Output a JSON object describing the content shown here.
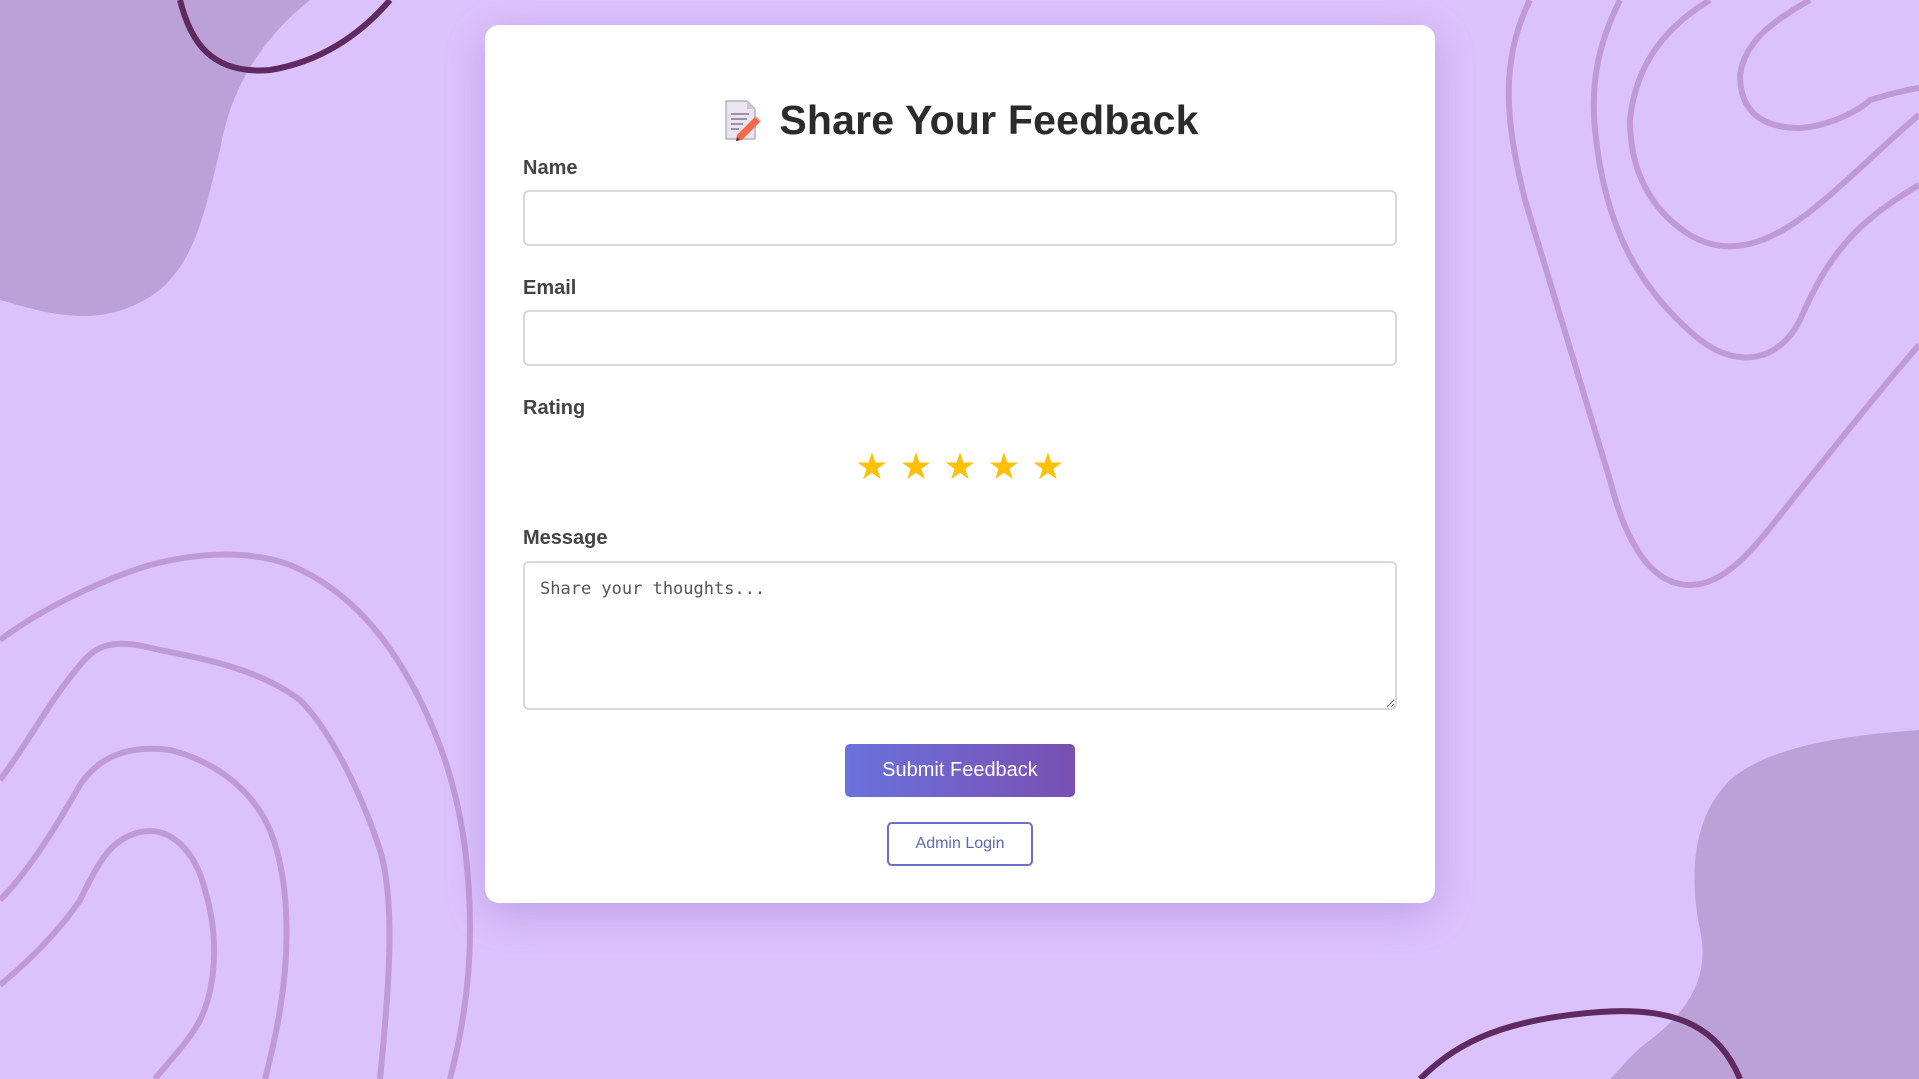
{
  "form": {
    "title": "Share Your Feedback",
    "title_icon": "memo-icon",
    "name_label": "Name",
    "name_value": "",
    "email_label": "Email",
    "email_value": "",
    "rating_label": "Rating",
    "rating": {
      "value": 5,
      "max": 5,
      "star_glyph": "★",
      "active_color": "#ffc107"
    },
    "message_label": "Message",
    "message_placeholder": "Share your thoughts...",
    "message_value": "",
    "submit_label": "Submit Feedback",
    "admin_label": "Admin Login"
  },
  "colors": {
    "background": "#dcc2fd",
    "accent_start": "#6a72dc",
    "accent_end": "#7a4fb2",
    "decoration_dark": "#5e2a5f",
    "decoration_blob": "#bba1d8"
  }
}
